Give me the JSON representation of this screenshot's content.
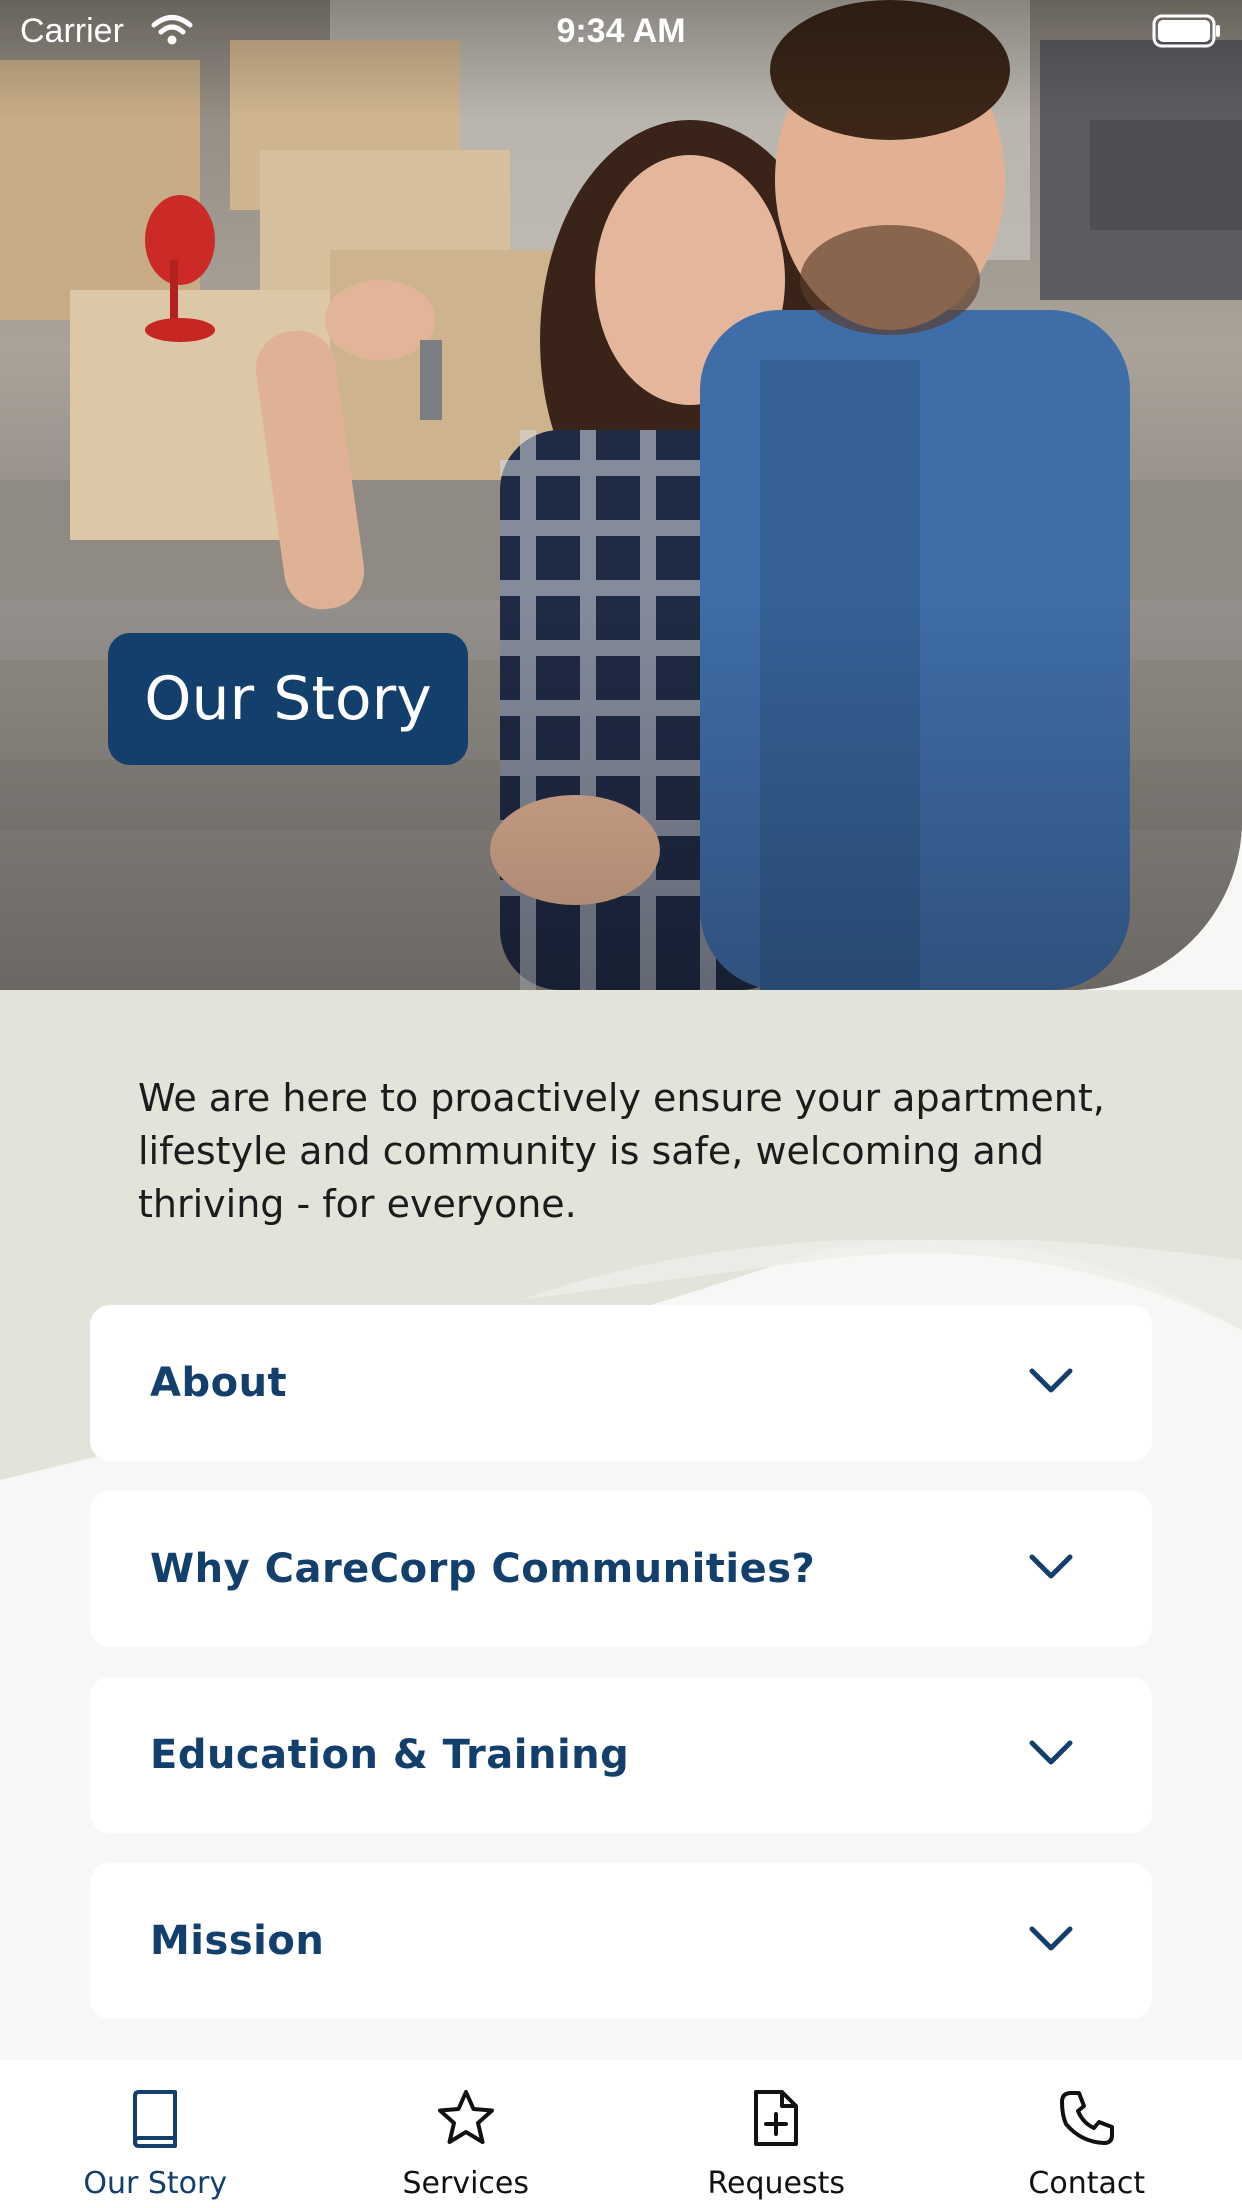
{
  "status_bar": {
    "carrier": "Carrier",
    "time": "9:34 AM"
  },
  "hero": {
    "title": "Our Story"
  },
  "intro": "We are here to proactively ensure your apartment, lifestyle and community is safe, welcoming and thriving - for everyone.",
  "accordion": [
    {
      "label": "About",
      "icon": "chevron-down-icon"
    },
    {
      "label": "Why CareCorp Communities?",
      "icon": "chevron-down-icon"
    },
    {
      "label": "Education & Training",
      "icon": "chevron-down-icon"
    },
    {
      "label": "Mission",
      "icon": "chevron-down-icon"
    }
  ],
  "tabs": [
    {
      "label": "Our Story",
      "icon": "book-icon",
      "active": true
    },
    {
      "label": "Services",
      "icon": "star-icon",
      "active": false
    },
    {
      "label": "Requests",
      "icon": "file-plus-icon",
      "active": false
    },
    {
      "label": "Contact",
      "icon": "phone-icon",
      "active": false
    }
  ],
  "colors": {
    "brand_navy": "#133f6d",
    "content_bg": "#e3e3da",
    "card_bg": "#ffffff"
  }
}
